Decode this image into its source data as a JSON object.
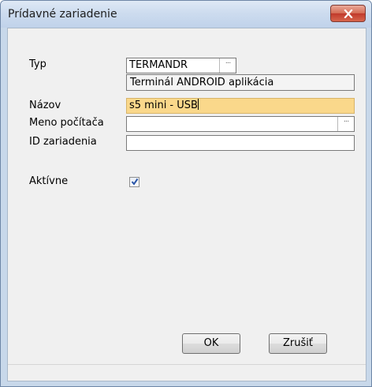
{
  "window": {
    "title": "Prídavné zariadenie",
    "close_icon": "close-icon"
  },
  "form": {
    "typ": {
      "label": "Typ",
      "value": "TERMANDR",
      "lookup_icon": "ellipsis-icon",
      "description": "Terminál ANDROID aplikácia"
    },
    "nazov": {
      "label": "Názov",
      "value": "s5 mini - USB"
    },
    "meno_pocitaca": {
      "label": "Meno počítača",
      "value": "",
      "lookup_icon": "ellipsis-icon"
    },
    "id_zariadenia": {
      "label": "ID zariadenia",
      "value": ""
    },
    "aktivne": {
      "label": "Aktívne",
      "checked": true
    }
  },
  "buttons": {
    "ok_label": "OK",
    "cancel_label": "Zrušiť"
  },
  "colors": {
    "highlight_field": "#fad88b",
    "close_button": "#c0392b"
  }
}
